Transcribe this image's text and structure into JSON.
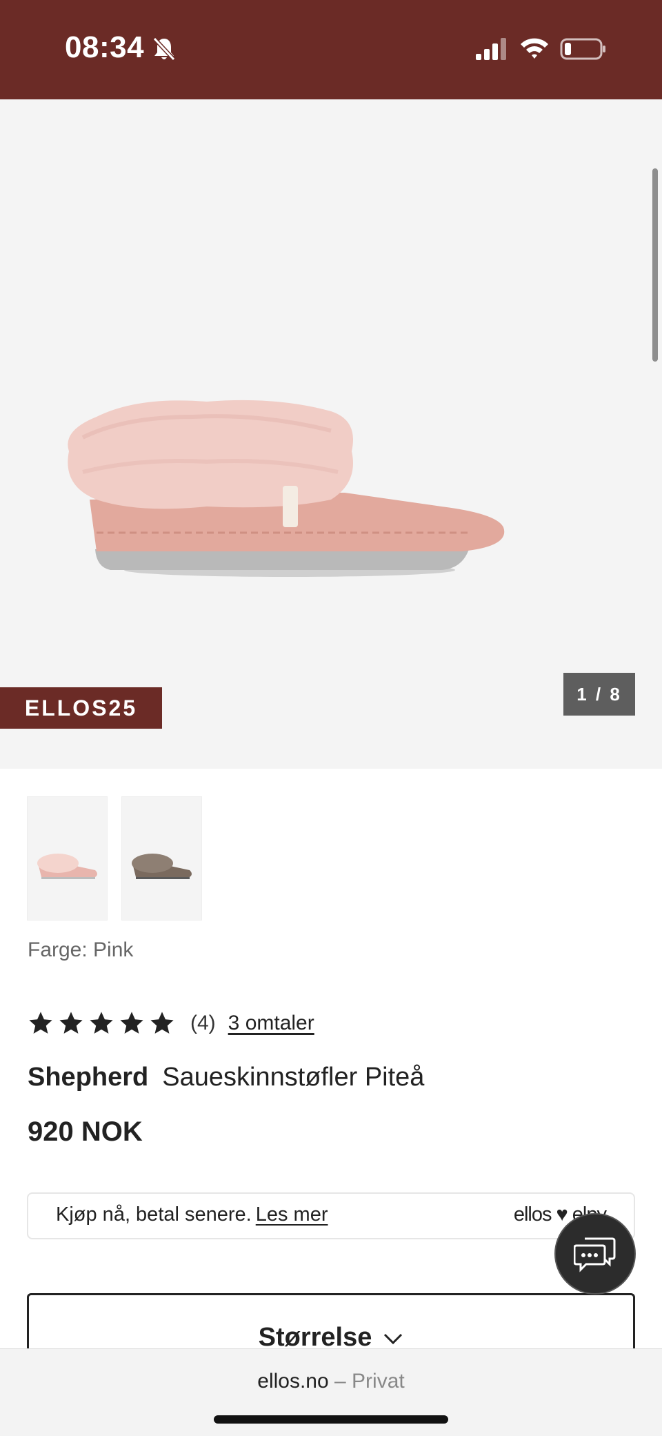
{
  "status_bar": {
    "time": "08:34",
    "background_color": "#6b2b26",
    "icons": [
      "bell-slash-icon",
      "signal-icon",
      "wifi-icon",
      "battery-low-icon"
    ]
  },
  "gallery": {
    "promo_badge": "ELLOS25",
    "image_counter": "1 / 8",
    "product_image": "pink-sheepskin-slipper"
  },
  "thumbnails": [
    {
      "color": "#e8b5ad",
      "name": "pink"
    },
    {
      "color": "#7a6a5e",
      "name": "brown"
    }
  ],
  "product": {
    "color_label": "Farge: Pink",
    "rating": {
      "stars": 5,
      "count": "(4)",
      "reviews_link": "3 omtaler"
    },
    "brand": "Shepherd",
    "name": "Saueskinnstøfler Piteå",
    "price": "920 NOK"
  },
  "pay_later": {
    "text": "Kjøp nå, betal senere.",
    "link": "Les mer",
    "brand": "ellos ♥ elpy"
  },
  "size_selector": {
    "label": "Størrelse"
  },
  "browser": {
    "domain": "ellos.no",
    "separator": "–",
    "mode": "Privat"
  }
}
